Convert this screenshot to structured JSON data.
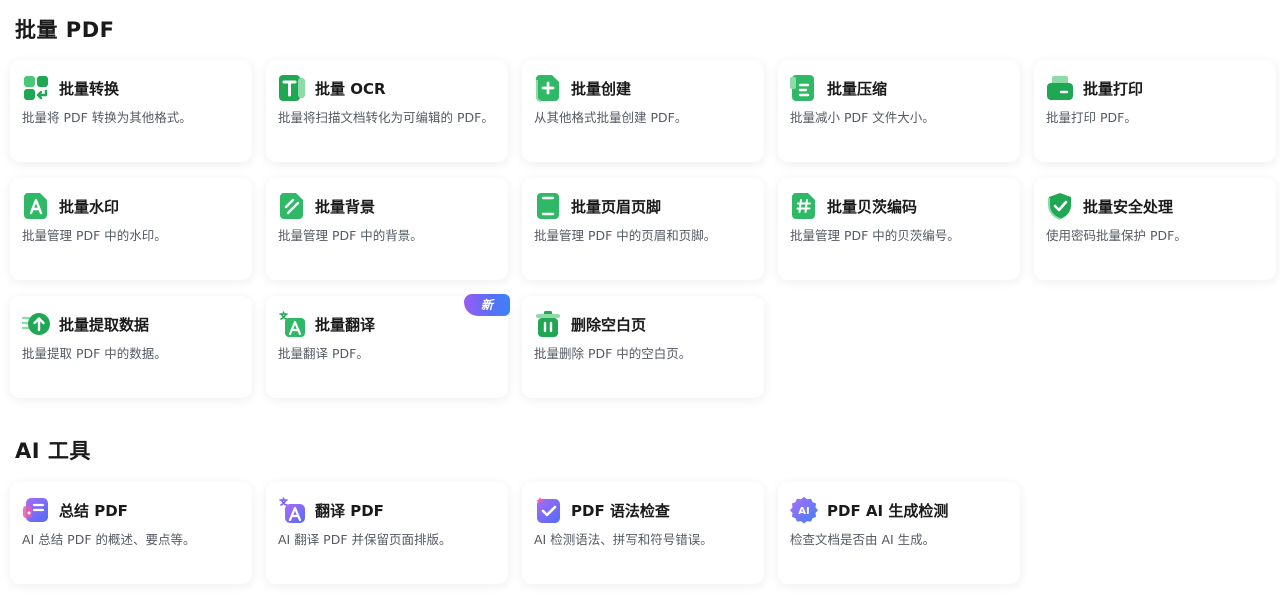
{
  "sections": [
    {
      "title": "批量 PDF",
      "cards": [
        {
          "title": "批量转换",
          "desc": "批量将 PDF 转换为其他格式。",
          "icon": "batch-convert-icon"
        },
        {
          "title": "批量 OCR",
          "desc": "批量将扫描文档转化为可编辑的 PDF。",
          "icon": "batch-ocr-icon"
        },
        {
          "title": "批量创建",
          "desc": "从其他格式批量创建 PDF。",
          "icon": "batch-create-icon"
        },
        {
          "title": "批量压缩",
          "desc": "批量减小 PDF 文件大小。",
          "icon": "batch-compress-icon"
        },
        {
          "title": "批量打印",
          "desc": "批量打印 PDF。",
          "icon": "batch-print-icon"
        },
        {
          "title": "批量水印",
          "desc": "批量管理 PDF 中的水印。",
          "icon": "batch-watermark-icon"
        },
        {
          "title": "批量背景",
          "desc": "批量管理 PDF 中的背景。",
          "icon": "batch-background-icon"
        },
        {
          "title": "批量页眉页脚",
          "desc": "批量管理 PDF 中的页眉和页脚。",
          "icon": "batch-header-footer-icon"
        },
        {
          "title": "批量贝茨编码",
          "desc": "批量管理 PDF 中的贝茨编号。",
          "icon": "batch-bates-icon"
        },
        {
          "title": "批量安全处理",
          "desc": "使用密码批量保护 PDF。",
          "icon": "batch-security-icon"
        },
        {
          "title": "批量提取数据",
          "desc": "批量提取 PDF 中的数据。",
          "icon": "batch-extract-icon"
        },
        {
          "title": "批量翻译",
          "desc": "批量翻译 PDF。",
          "icon": "batch-translate-icon",
          "badge": "新"
        },
        {
          "title": "删除空白页",
          "desc": "批量删除 PDF 中的空白页。",
          "icon": "delete-blank-page-icon"
        }
      ]
    },
    {
      "title": "AI 工具",
      "cards": [
        {
          "title": "总结 PDF",
          "desc": "AI 总结 PDF 的概述、要点等。",
          "icon": "ai-summarize-icon"
        },
        {
          "title": "翻译 PDF",
          "desc": "AI 翻译 PDF 并保留页面排版。",
          "icon": "ai-translate-icon"
        },
        {
          "title": "PDF 语法检查",
          "desc": "AI 检测语法、拼写和符号错误。",
          "icon": "ai-grammar-check-icon"
        },
        {
          "title": "PDF AI 生成检测",
          "desc": "检查文档是否由 AI 生成。",
          "icon": "ai-detect-icon"
        }
      ]
    }
  ],
  "colors": {
    "green_light": "#49c877",
    "green_dark": "#1fa754",
    "ai_purple": "#7c5cf6",
    "ai_blue": "#3b82f6",
    "ai_pink": "#e85aa8"
  }
}
